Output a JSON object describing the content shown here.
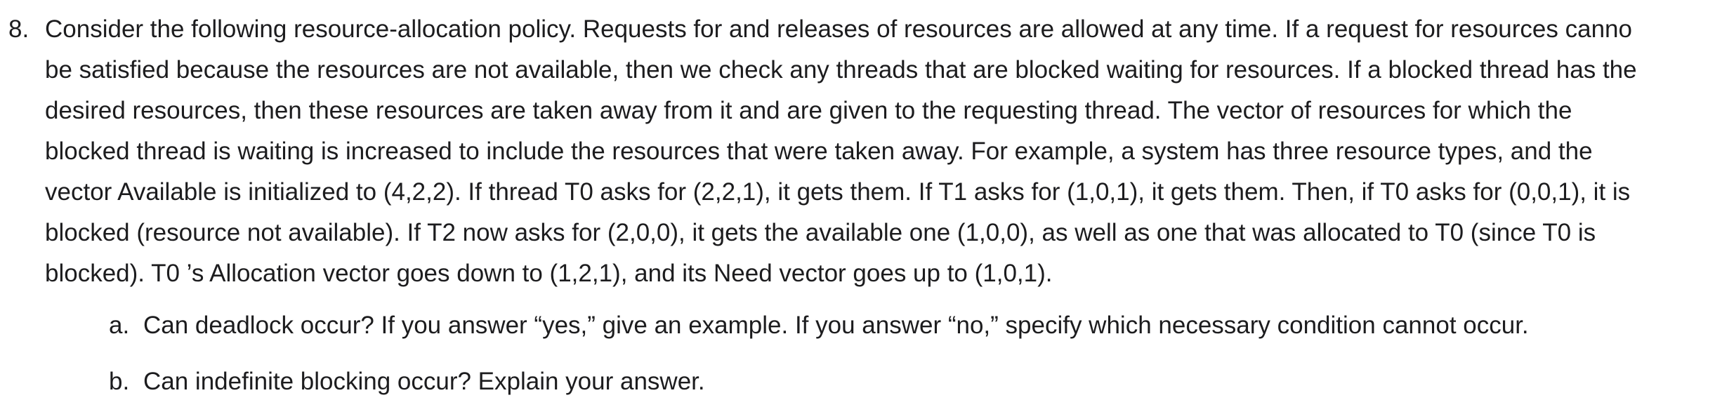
{
  "question": {
    "number": "8.",
    "lines": [
      "Consider the following resource-allocation policy. Requests for and releases of resources are allowed at any time. If a request for resources canno",
      "be satisfied because the resources are not available, then we check any threads that are blocked waiting for resources. If a blocked thread has the",
      "desired resources, then these resources are taken away from it and are given to the requesting thread. The vector of resources for which the",
      "blocked thread is waiting is increased to include the resources that were taken away. For example, a system has three resource types, and the",
      "vector Available is initialized to (4,2,2). If thread T0 asks for (2,2,1), it gets them. If T1 asks for (1,0,1), it gets them. Then, if T0 asks for (0,0,1), it is",
      "blocked (resource not available). If T2 now asks for (2,0,0), it gets the available one (1,0,0), as well as one that was allocated to T0 (since T0 is",
      "blocked). T0 ’s Allocation vector goes down to (1,2,1), and its Need vector goes up to (1,0,1)."
    ]
  },
  "sub_questions": [
    {
      "marker": "a.",
      "text": "Can deadlock occur? If you answer “yes,” give an example. If you answer “no,” specify which necessary condition cannot occur."
    },
    {
      "marker": "b.",
      "text": "Can indefinite blocking occur? Explain your answer."
    }
  ]
}
